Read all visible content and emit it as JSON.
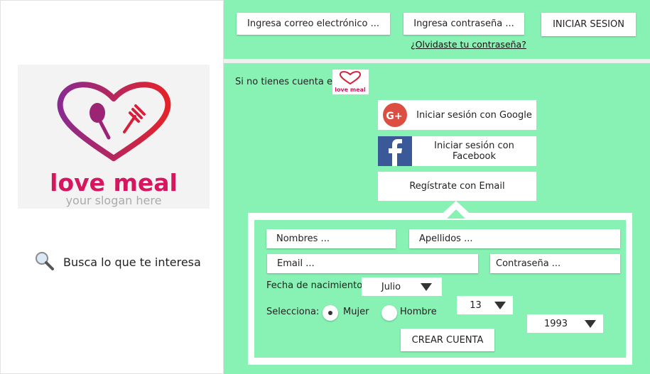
{
  "header": {
    "email_placeholder": "Ingresa correo electrónico ...",
    "password_placeholder": "Ingresa contraseña ...",
    "login_button": "INICIAR SESION",
    "forgot_link": "¿Olvidaste tu contraseña?"
  },
  "brand": {
    "logo_text": "love meal",
    "slogan": "your slogan here",
    "logo_color": "#d6175f"
  },
  "search": {
    "label": "Busca lo que te interesa"
  },
  "signup": {
    "intro": "Si no tienes cuenta en",
    "google_label": "Iniciar sesión con Google",
    "facebook_label": "Iniciar sesión con Facebook",
    "email_label": "Regístrate con Email",
    "google_color": "#dc4e41",
    "facebook_color": "#3b5998"
  },
  "form": {
    "first_name": "Nombres ...",
    "last_name": "Apellidos ...",
    "email": "Email ...",
    "password": "Contraseña ...",
    "birth_label": "Fecha de nacimiento:",
    "month": "Julio",
    "day": "13",
    "year": "1993",
    "select_label": "Selecciona:",
    "gender_female": "Mujer",
    "gender_male": "Hombre",
    "gender_selected": "Mujer",
    "create_button": "CREAR CUENTA"
  },
  "colors": {
    "panel_green": "#87f2b4"
  }
}
